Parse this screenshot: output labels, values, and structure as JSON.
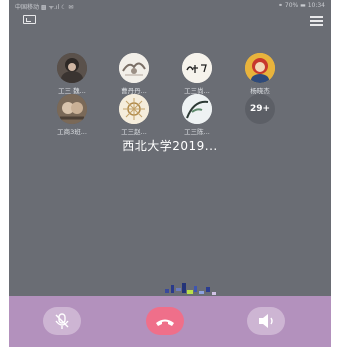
{
  "status": {
    "left_text": "中国移动 ▩ ᯤ.ıl ☾ ✉",
    "right_text": "⚭ 70% ▬ 10:34"
  },
  "participants": [
    {
      "name": "工三 魏..."
    },
    {
      "name": "曹丹丹..."
    },
    {
      "name": "工三尚..."
    },
    {
      "name": "杨晓杰"
    },
    {
      "name": "工商3班..."
    },
    {
      "name": "工三赵..."
    },
    {
      "name": "工三陈..."
    }
  ],
  "more_count": "29+",
  "group_name": "西北大学2019...",
  "colors": {
    "background": "#6a6d74",
    "bottom_bar": "#b391bd",
    "hangup": "#ef6f8a",
    "control": "#cdb5d3"
  },
  "icons": {
    "minimize": "minimize-window-icon",
    "menu": "menu-icon",
    "mute": "microphone-muted-icon",
    "hangup": "phone-hangup-icon",
    "speaker": "speaker-icon"
  }
}
